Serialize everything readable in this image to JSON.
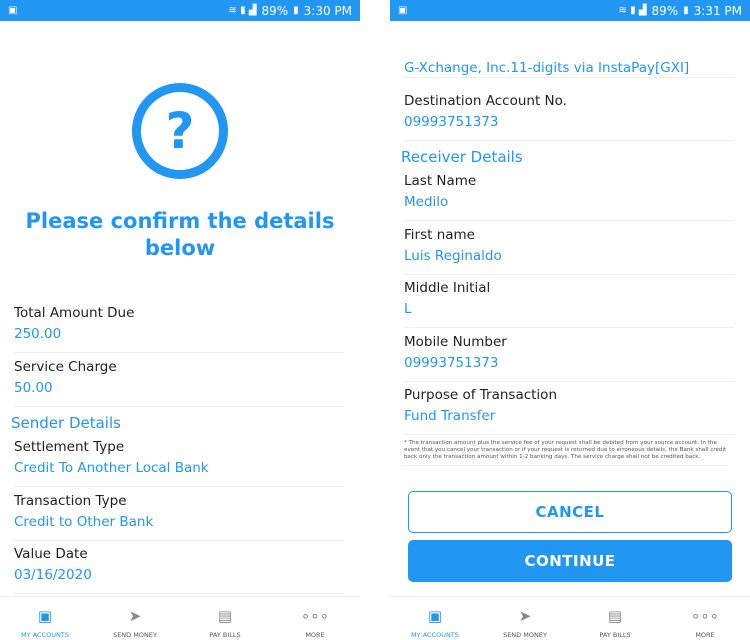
{
  "colors": {
    "accent": "#2196f3"
  },
  "screen1": {
    "status": {
      "battery": "89%",
      "time": "3:30 PM"
    },
    "title_line1": "Please confirm the details",
    "title_line2": "below",
    "fields": [
      {
        "label": "Total Amount Due",
        "value": "250.00"
      },
      {
        "label": "Service Charge",
        "value": "50.00"
      }
    ],
    "sender_heading": "Sender Details",
    "sender_fields": [
      {
        "label": "Settlement Type",
        "value": "Credit To Another Local Bank"
      },
      {
        "label": "Transaction Type",
        "value": "Credit to Other Bank"
      },
      {
        "label": "Value Date",
        "value": "03/16/2020"
      }
    ]
  },
  "screen2": {
    "status": {
      "battery": "89%",
      "time": "3:31 PM"
    },
    "bank_value": "G-Xchange, Inc.11-digits via InstaPay[GXI]",
    "dest": {
      "label": "Destination Account No.",
      "value": "09993751373"
    },
    "receiver_heading": "Receiver Details",
    "receiver_fields": [
      {
        "label": "Last Name",
        "value": "Medilo"
      },
      {
        "label": "First name",
        "value": "Luis Reginaldo"
      },
      {
        "label": "Middle Initial",
        "value": "L"
      },
      {
        "label": "Mobile Number",
        "value": "09993751373"
      },
      {
        "label": "Purpose of Transaction",
        "value": "Fund Transfer"
      }
    ],
    "note": "* The transaction amount plus the service fee of your request shall be debited from your source account. In the event that you cancel your transaction or if your request is returned due to erroneous details, the Bank shall credit back only the transaction amount within 1-2 banking days. The service charge shall not be credited back.",
    "cancel_label": "CANCEL",
    "continue_label": "CONTINUE"
  },
  "nav": [
    {
      "label": "MY ACCOUNTS",
      "icon": "money-icon"
    },
    {
      "label": "SEND MONEY",
      "icon": "paper-plane-icon"
    },
    {
      "label": "PAY BILLS",
      "icon": "bill-icon"
    },
    {
      "label": "MORE",
      "icon": "more-icon"
    }
  ]
}
